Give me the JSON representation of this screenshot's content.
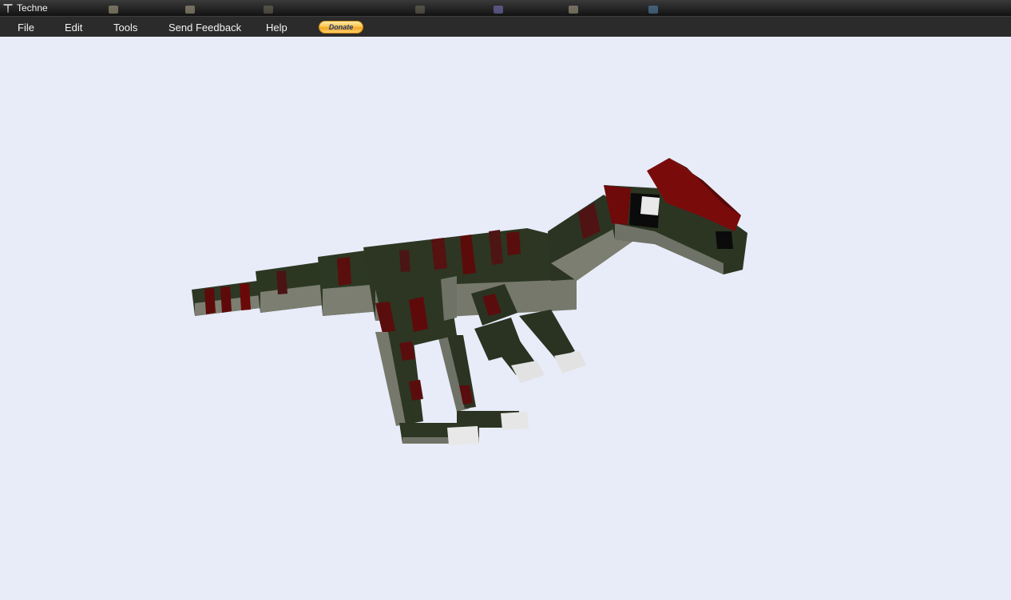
{
  "window": {
    "title": "Techne"
  },
  "menu": {
    "items": [
      {
        "label": "File"
      },
      {
        "label": "Edit"
      },
      {
        "label": "Tools"
      },
      {
        "label": "Send Feedback"
      },
      {
        "label": "Help"
      }
    ],
    "donate_label": "Donate"
  },
  "icons": {
    "app": "techne-logo-icon",
    "model": "raptor-model"
  },
  "colors": {
    "viewport_bg": "#e8ecf9",
    "menubar_bg": "#2b2b2b",
    "model_green": "#2f3a26",
    "model_red": "#5c0b0b",
    "model_grey": "#7b7e70"
  }
}
